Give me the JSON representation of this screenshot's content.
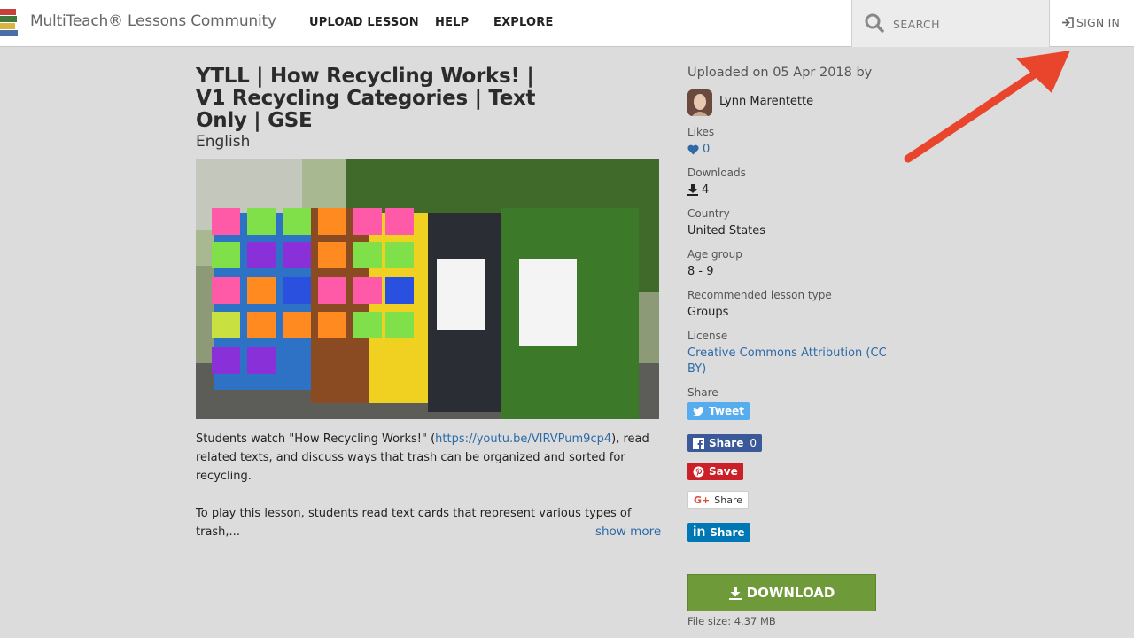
{
  "header": {
    "brand": "MultiTeach® Lessons Community",
    "nav": [
      "UPLOAD LESSON",
      "HELP",
      "EXPLORE"
    ],
    "search_placeholder": "SEARCH",
    "signin": "SIGN IN"
  },
  "lesson": {
    "title": "YTLL | How Recycling Works! | V1 Recycling Categories | Text Only | GSE",
    "language": "English",
    "desc_p1_a": "Students watch \"How Recycling Works!\" (",
    "desc_link": "https://youtu.be/VIRVPum9cp4",
    "desc_p1_b": "), read related texts, and discuss ways that trash can be organized and sorted for recycling.",
    "desc_p2": "To play this lesson, students read text cards that represent various types of trash,...",
    "show_more": "show more"
  },
  "sidebar": {
    "uploaded": "Uploaded on 05 Apr 2018 by",
    "author": "Lynn Marentette",
    "likes_label": "Likes",
    "likes_value": "0",
    "downloads_label": "Downloads",
    "downloads_value": "4",
    "country_label": "Country",
    "country_value": "United States",
    "age_label": "Age group",
    "age_value": "8 - 9",
    "lesson_type_label": "Recommended lesson type",
    "lesson_type_value": "Groups",
    "license_label": "License",
    "license_value": "Creative Commons Attribution (CC BY)",
    "share_label": "Share",
    "tweet": "Tweet",
    "fb_share": "Share",
    "fb_count": "0",
    "pin_save": "Save",
    "gplus_share": "Share",
    "li_share": "Share",
    "download": "DOWNLOAD",
    "file_size": "File size: 4.37 MB"
  },
  "colors": {
    "accent_link": "#2e6aa8",
    "download_green": "#6e9a3a",
    "annotation_red": "#e8452c"
  }
}
